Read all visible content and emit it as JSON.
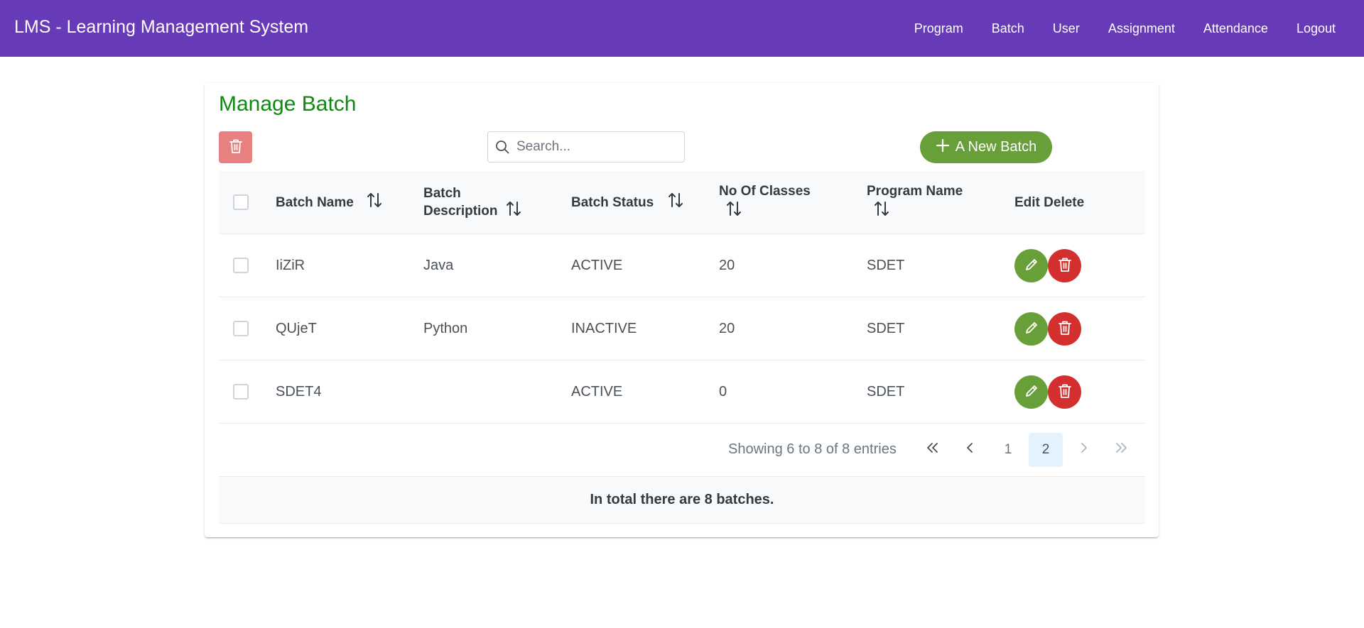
{
  "header": {
    "title": "LMS - Learning Management System",
    "nav": [
      "Program",
      "Batch",
      "User",
      "Assignment",
      "Attendance",
      "Logout"
    ]
  },
  "page": {
    "title": "Manage Batch",
    "search_placeholder": "Search...",
    "new_button_label": "A New Batch"
  },
  "table": {
    "columns": [
      "Batch Name",
      "Batch Description",
      "Batch Status",
      "No Of Classes",
      "Program Name",
      "Edit Delete"
    ],
    "rows": [
      {
        "name": "IiZiR",
        "description": "Java",
        "status": "ACTIVE",
        "classes": "20",
        "program": "SDET"
      },
      {
        "name": "QUjeT",
        "description": "Python",
        "status": "INACTIVE",
        "classes": "20",
        "program": "SDET"
      },
      {
        "name": "SDET4",
        "description": "",
        "status": "ACTIVE",
        "classes": "0",
        "program": "SDET"
      }
    ]
  },
  "paginator": {
    "report": "Showing 6 to 8 of 8 entries",
    "pages": [
      "1",
      "2"
    ],
    "current_page": "2"
  },
  "footer": {
    "summary": "In total there are 8 batches."
  },
  "colors": {
    "header": "#673ab7",
    "title": "#0f8a0f",
    "success": "#689f38",
    "danger": "#d32f2f",
    "bulk_delete": "#e88080"
  }
}
